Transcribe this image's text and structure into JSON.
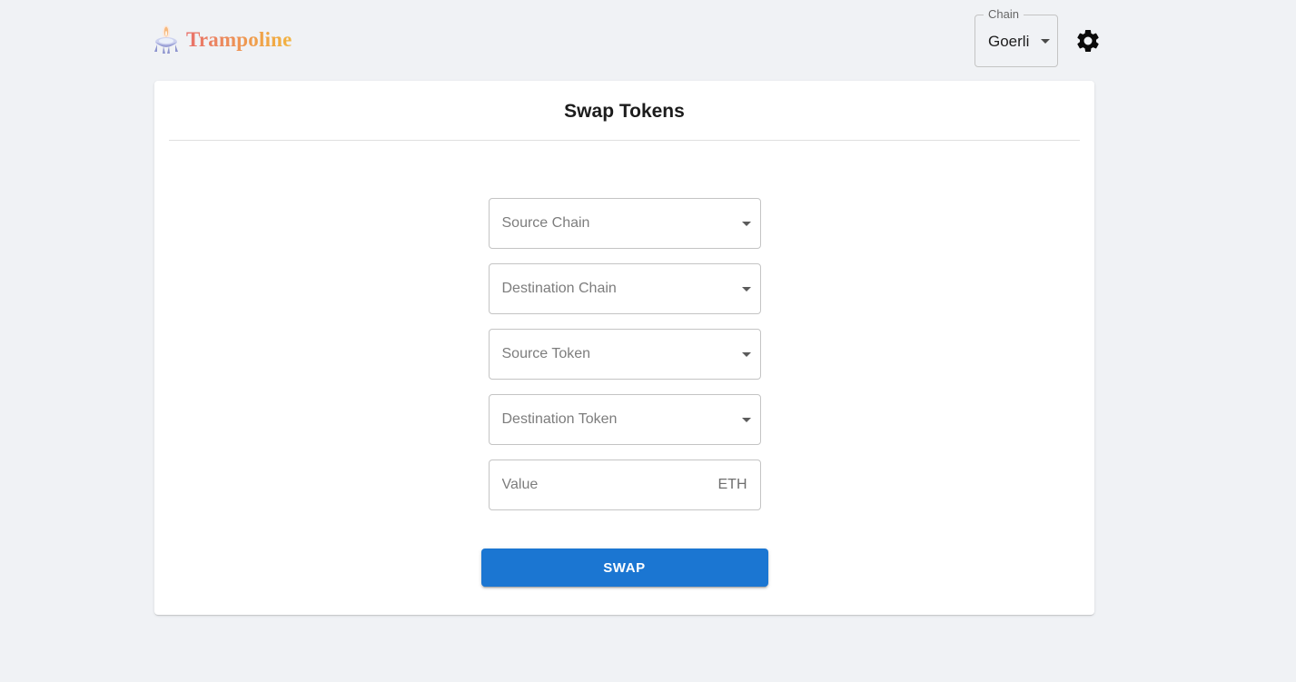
{
  "header": {
    "brand_name": "Trampoline",
    "brand_icon": "trampoline-rocket-icon",
    "chain_selector": {
      "legend": "Chain",
      "value": "Goerli",
      "arrow_icon": "chevron-down-icon"
    },
    "settings_icon": "gear-icon"
  },
  "card": {
    "title": "Swap Tokens",
    "fields": [
      {
        "name": "source-chain",
        "label": "Source Chain",
        "type": "select",
        "arrow_icon": "chevron-down-icon"
      },
      {
        "name": "destination-chain",
        "label": "Destination Chain",
        "type": "select",
        "arrow_icon": "chevron-down-icon"
      },
      {
        "name": "source-token",
        "label": "Source Token",
        "type": "select",
        "arrow_icon": "chevron-down-icon"
      },
      {
        "name": "destination-token",
        "label": "Destination Token",
        "type": "select",
        "arrow_icon": "chevron-down-icon"
      }
    ],
    "value_field": {
      "placeholder": "Value",
      "value": "",
      "adornment": "ETH"
    },
    "submit_label": "SWAP"
  },
  "colors": {
    "page_background": "#f0f2f5",
    "card_background": "#ffffff",
    "primary": "#1b76d2",
    "border": "#c4c4c4",
    "placeholder_text": "#7d7d7d",
    "brand_gradient_start": "#e8706a",
    "brand_gradient_end": "#f2b441"
  }
}
